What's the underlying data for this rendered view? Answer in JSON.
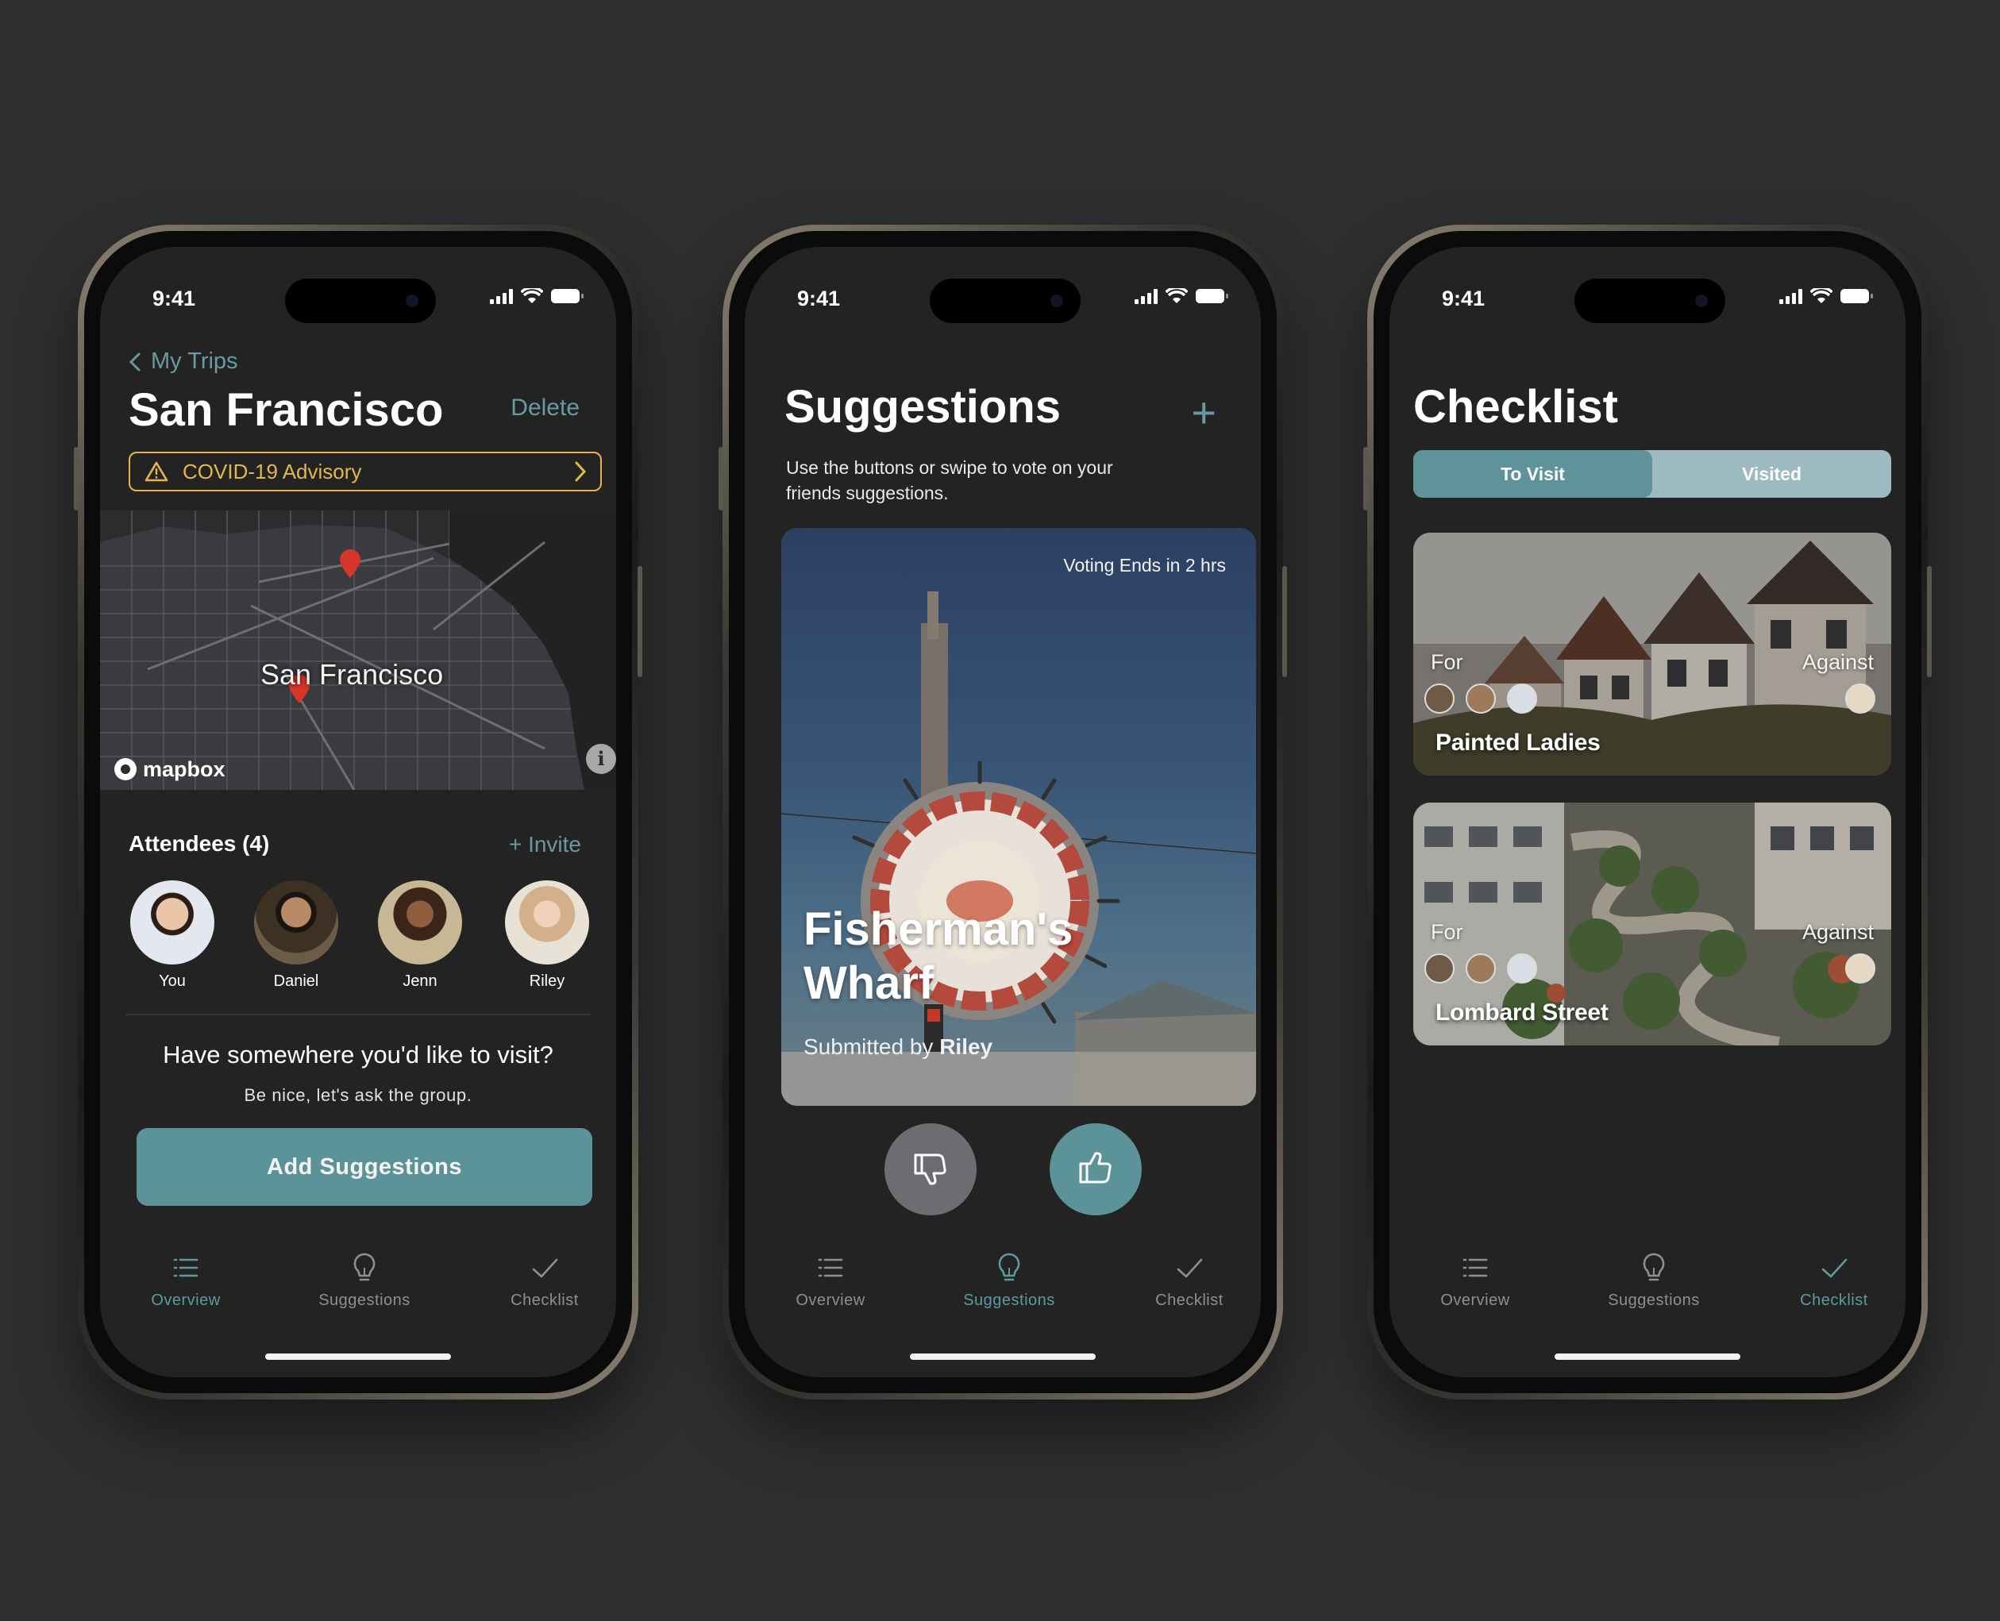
{
  "status": {
    "time": "9:41"
  },
  "tabs": {
    "overview": "Overview",
    "suggestions": "Suggestions",
    "checklist": "Checklist"
  },
  "overview": {
    "back_label": "My Trips",
    "title": "San Francisco",
    "delete_label": "Delete",
    "advisory_label": "COVID-19 Advisory",
    "map_label": "San Francisco",
    "map_brand": "mapbox",
    "map_info": "i",
    "attendees_label": "Attendees (4)",
    "invite_label": "+ Invite",
    "attendees": [
      {
        "name": "You"
      },
      {
        "name": "Daniel"
      },
      {
        "name": "Jenn"
      },
      {
        "name": "Riley"
      }
    ],
    "prompt": "Have somewhere you'd like to visit?",
    "subprompt": "Be nice, let's ask the group.",
    "cta_label": "Add Suggestions"
  },
  "suggestions": {
    "title": "Suggestions",
    "add_label": "+",
    "description": "Use the buttons or swipe to vote on your friends suggestions.",
    "card": {
      "voting": "Voting Ends in 2 hrs",
      "title": "Fisherman's Wharf",
      "submitted_prefix": "Submitted by",
      "submitted_by": "Riley"
    }
  },
  "checklist": {
    "title": "Checklist",
    "segments": [
      "To Visit",
      "Visited"
    ],
    "places": [
      {
        "name": "Painted Ladies",
        "for_label": "For",
        "against_label": "Against"
      },
      {
        "name": "Lombard Street",
        "for_label": "For",
        "against_label": "Against"
      }
    ]
  },
  "colors": {
    "accent": "#5d9aa0",
    "warning": "#e5b74a",
    "background": "#2f2f2f",
    "screen": "#232323"
  }
}
